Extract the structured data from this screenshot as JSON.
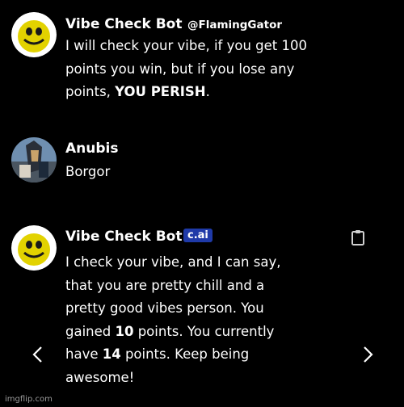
{
  "messages": [
    {
      "name": "Vibe Check Bot",
      "handle": "@FlamingGator",
      "lines": [
        "I will check your vibe, if you get 100",
        "points you win, but if you lose any",
        "points, |YOU PERISH|."
      ]
    },
    {
      "name": "Anubis",
      "lines": [
        "Borgor"
      ]
    },
    {
      "name": "Vibe Check Bot",
      "badge": "c.ai",
      "lines": [
        "I check your vibe, and I can say,",
        "that you are pretty chill and a",
        "pretty good vibes person. You",
        "gained |10| points. You currently",
        "have |14| points. Keep being",
        "awesome!"
      ]
    }
  ],
  "footer": "imgflip.com",
  "icons": {
    "clipboard": "clipboard-icon",
    "prev": "chevron-left-icon",
    "next": "chevron-right-icon"
  }
}
